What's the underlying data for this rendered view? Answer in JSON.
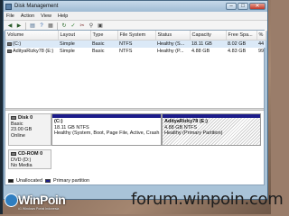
{
  "window": {
    "title": "Disk Management"
  },
  "window_buttons": {
    "minimize": "–",
    "maximize": "□",
    "close": "✕"
  },
  "menu": [
    "File",
    "Action",
    "View",
    "Help"
  ],
  "toolbar_icons": [
    "back-arrow-icon",
    "forward-arrow-icon",
    "disk-list-icon",
    "help-icon",
    "properties-icon",
    "refresh-icon",
    "check-icon",
    "cut-icon",
    "search-icon",
    "view-icon"
  ],
  "volume_table": {
    "headers": [
      "Volume",
      "Layout",
      "Type",
      "File System",
      "Status",
      "Capacity",
      "Free Spa...",
      "%"
    ],
    "rows": [
      [
        "(C:)",
        "Simple",
        "Basic",
        "NTFS",
        "Healthy (S...",
        "18.11 GB",
        "8.02 GB",
        "44"
      ],
      [
        "AdityaRizky78 (E:)",
        "Simple",
        "Basic",
        "NTFS",
        "Healthy (P...",
        "4.88 GB",
        "4.83 GB",
        "99"
      ]
    ]
  },
  "disks": [
    {
      "name": "Disk 0",
      "type": "Basic",
      "size": "23.00 GB",
      "status": "Online",
      "partitions": [
        {
          "name": "(C:)",
          "size": "18.11 GB NTFS",
          "status": "Healthy (System, Boot, Page File, Active, Crash D"
        },
        {
          "name": "AdityaRizky78  (E:)",
          "size": "4.88 GB NTFS",
          "status": "Healthy (Primary Partition)"
        }
      ]
    },
    {
      "name": "CD-ROM 0",
      "type": "DVD (D:)",
      "size": "",
      "status": "No Media"
    }
  ],
  "legend": {
    "unallocated": "Unallocated",
    "primary": "Primary partition"
  },
  "colors": {
    "primary_partition": "#1c1c8a",
    "unallocated": "#1a1a1a"
  },
  "watermark": {
    "brand": "WinPoin",
    "tagline": "#1 Windows Portal Indonesia",
    "url": "forum.winpoin.com"
  }
}
